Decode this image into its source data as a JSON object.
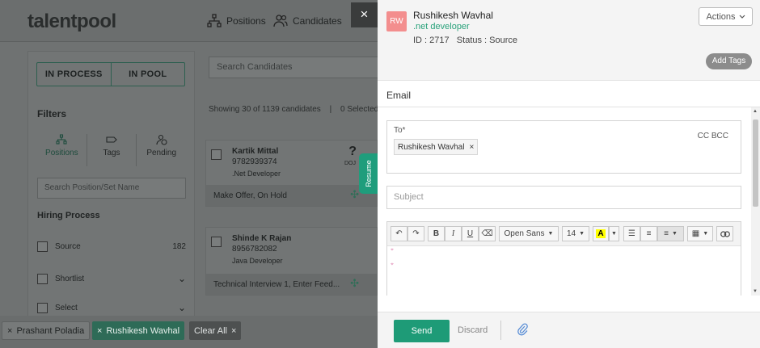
{
  "app": {
    "logo": "talentpool",
    "nav": {
      "positions": "Positions",
      "candidates": "Candidates"
    }
  },
  "left_panel": {
    "segment": [
      "IN PROCESS",
      "IN POOL"
    ],
    "filters_heading": "Filters",
    "filter_tabs": [
      "Positions",
      "Tags",
      "Pending"
    ],
    "search_placeholder": "Search Position/Set Name",
    "hiring_heading": "Hiring Process",
    "stages": [
      {
        "label": "Source",
        "count": "182"
      },
      {
        "label": "Shortlist"
      },
      {
        "label": "Select"
      }
    ]
  },
  "candidates": {
    "search_placeholder": "Search Candidates",
    "showing": "Showing 30 of 1139 candidates",
    "selected": "0 Selected",
    "cards": [
      {
        "name": "Kartik Mittal",
        "phone": "9782939374",
        "role": ".Net Developer",
        "status": "Make Offer, On Hold",
        "badge": "?",
        "badge_label": "DOJ"
      },
      {
        "name": "Shinde K Rajan",
        "phone": "8956782082",
        "role": "Java Developer",
        "status": "Technical Interview 1, Enter Feed..."
      }
    ]
  },
  "chips": [
    {
      "label": "Prashant Poladia",
      "style": "gray"
    },
    {
      "label": "Rushikesh Wavhal",
      "style": "green"
    },
    {
      "label": "Clear All",
      "style": "dark"
    }
  ],
  "resume_tab": "Resume",
  "close_glyph": "×",
  "drawer": {
    "avatar": "RW",
    "name": "Rushikesh Wavhal",
    "role": ".net developer",
    "meta": "ID : 2717   Status : Source",
    "actions_label": "Actions",
    "add_tags": "Add Tags",
    "email_title": "Email",
    "to_label": "To*",
    "cc_bcc": "CC BCC",
    "recipient": "Rushikesh Wavhal",
    "subject_placeholder": "Subject",
    "toolbar": {
      "font": "Open Sans",
      "size": "14",
      "bold": "B",
      "italic": "I",
      "underline": "U",
      "color_letter": "A"
    },
    "send": "Send",
    "discard": "Discard"
  },
  "colors": {
    "accent": "#1e9b77",
    "avatar": "#f38e8e",
    "highlight": "#ffff00"
  }
}
